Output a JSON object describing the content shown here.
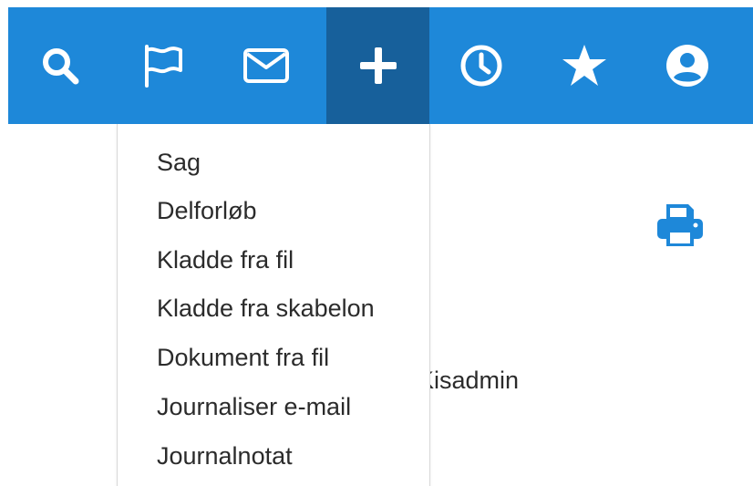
{
  "topbar": {
    "color": "#1e88d9",
    "active_color": "#17609b",
    "buttons": [
      {
        "icon": "search-icon"
      },
      {
        "icon": "flag-icon"
      },
      {
        "icon": "envelope-icon"
      },
      {
        "icon": "plus-icon",
        "active": true
      },
      {
        "icon": "clock-icon"
      },
      {
        "icon": "star-icon"
      },
      {
        "icon": "user-icon"
      }
    ]
  },
  "dropdown": {
    "items": [
      {
        "label": "Sag"
      },
      {
        "label": "Delforløb"
      },
      {
        "label": "Kladde fra fil"
      },
      {
        "label": "Kladde fra skabelon"
      },
      {
        "label": "Dokument fra fil"
      },
      {
        "label": "Journaliser e-mail"
      },
      {
        "label": "Journalnotat"
      }
    ]
  },
  "background": {
    "user_text": "Kisadmin"
  },
  "print": {
    "icon": "print-icon",
    "color": "#1e88d9"
  }
}
